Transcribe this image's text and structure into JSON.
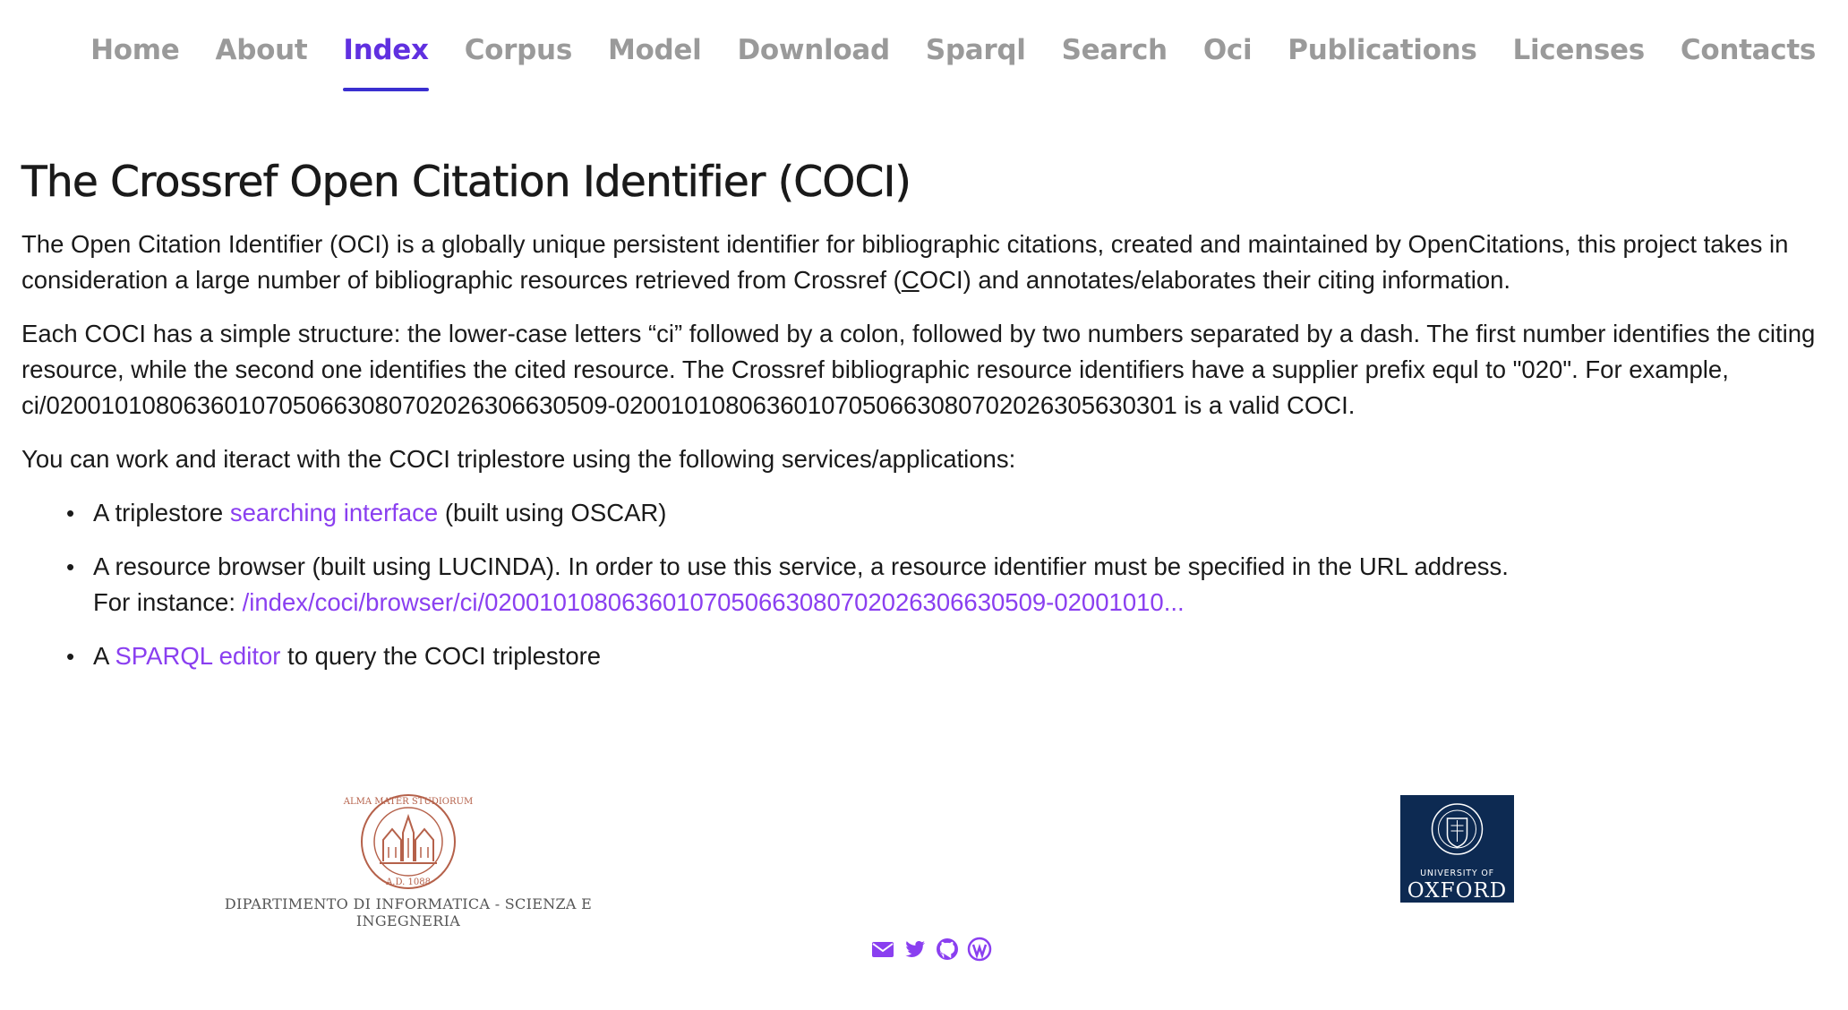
{
  "nav": {
    "items": [
      {
        "label": "Home",
        "active": false
      },
      {
        "label": "About",
        "active": false
      },
      {
        "label": "Index",
        "active": true
      },
      {
        "label": "Corpus",
        "active": false
      },
      {
        "label": "Model",
        "active": false
      },
      {
        "label": "Download",
        "active": false
      },
      {
        "label": "Sparql",
        "active": false
      },
      {
        "label": "Search",
        "active": false
      },
      {
        "label": "Oci",
        "active": false
      },
      {
        "label": "Publications",
        "active": false
      },
      {
        "label": "Licenses",
        "active": false
      },
      {
        "label": "Contacts",
        "active": false
      }
    ]
  },
  "main": {
    "title": "The Crossref Open Citation Identifier (COCI)",
    "intro_pre": "The Open Citation Identifier (OCI) is a globally unique persistent identifier for bibliographic citations, created and maintained by OpenCitations, this project takes in consideration a large number of bibliographic resources retrieved from Crossref (",
    "intro_u": "C",
    "intro_post": "OCI) and annotates/elaborates their citing information.",
    "structure": "Each COCI has a simple structure: the lower-case letters “ci” followed by a colon, followed by two numbers separated by a dash. The first number identifies the citing resource, while the second one identifies the cited resource. The Crossref bibliographic resource identifiers have a supplier prefix equl to \"020\". For example, ci/02001010806360107050663080702026306630509-02001010806360107050663080702026305630301 is a valid COCI.",
    "services_intro": "You can work and iteract with the COCI triplestore using the following services/applications:",
    "services": {
      "search_pre": "A triplestore ",
      "search_link": "searching interface",
      "search_post": " (built using OSCAR)",
      "browser_text": "A resource browser (built using LUCINDA). In order to use this service, a resource identifier must be specified in the URL address.",
      "browser_instance_label": "For instance: ",
      "browser_link": "/index/coci/browser/ci/02001010806360107050663080702026306630509-02001010...",
      "sparql_pre": "A ",
      "sparql_link": "SPARQL editor",
      "sparql_post": " to query the COCI triplestore"
    }
  },
  "footer": {
    "unibo_text": "DIPARTIMENTO DI INFORMATICA - SCIENZA E INGEGNERIA",
    "oxford_univ": "UNIVERSITY OF",
    "oxford_name": "OXFORD",
    "social_icons": [
      "envelope-icon",
      "twitter-icon",
      "github-icon",
      "wordpress-icon"
    ]
  },
  "colors": {
    "nav_inactive": "#9a9a9a",
    "nav_active": "#6030e0",
    "link": "#8a3ff0",
    "oxford_blue": "#0d2a52",
    "unibo_seal": "#b5614a"
  }
}
